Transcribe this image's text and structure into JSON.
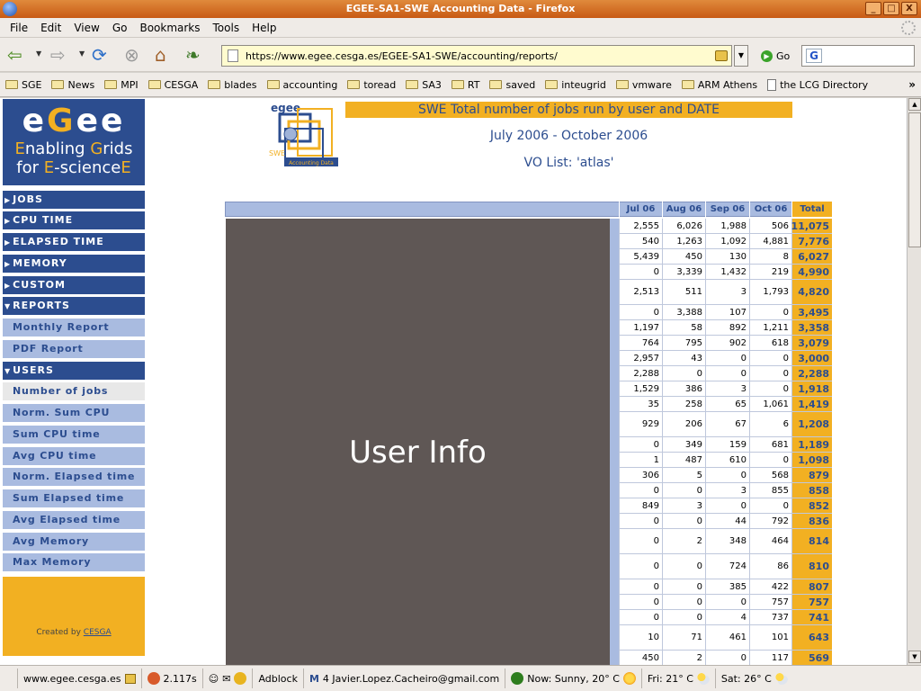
{
  "window": {
    "title": "EGEE-SA1-SWE Accounting Data - Firefox",
    "controls": [
      "_",
      "□",
      "X"
    ]
  },
  "menu": [
    "File",
    "Edit",
    "View",
    "Go",
    "Bookmarks",
    "Tools",
    "Help"
  ],
  "navbar": {
    "url": "https://www.egee.cesga.es/EGEE-SA1-SWE/accounting/reports/",
    "go_label": "Go"
  },
  "bookmarks": [
    "SGE",
    "News",
    "MPI",
    "CESGA",
    "blades",
    "accounting",
    "toread",
    "SA3",
    "RT",
    "saved",
    "inteugrid",
    "vmware",
    "ARM Athens",
    "the LCG Directory"
  ],
  "bookmarks_more": "»",
  "sidebar": {
    "logo": {
      "line1_a": "e",
      "line1_b": "G",
      "line1_c": "ee",
      "line2_a": "E",
      "line2_b": "nabling ",
      "line2_c": "G",
      "line2_d": "rids",
      "line3_a": "for ",
      "line3_b": "E",
      "line3_c": "-science",
      "line3_d": "E"
    },
    "sections": [
      "JOBS",
      "CPU TIME",
      "ELAPSED TIME",
      "MEMORY",
      "CUSTOM",
      "REPORTS"
    ],
    "reports_items": [
      "Monthly Report",
      "PDF Report"
    ],
    "users_label": "USERS",
    "users_items": [
      "Number of jobs",
      "Norm. Sum CPU",
      "Sum CPU time",
      "Avg CPU time",
      "Norm. Elapsed time",
      "Sum Elapsed time",
      "Avg Elapsed time",
      "Avg Memory",
      "Max Memory"
    ],
    "created_prefix": "Created by ",
    "created_link": "CESGA"
  },
  "report": {
    "logo_text": "SWE",
    "logo_caption": "Accounting Data",
    "title": "SWE Total number of jobs run by user and DATE",
    "period": "July 2006 - October 2006",
    "vo": "VO List: 'atlas'",
    "userinfo_label": "User Info",
    "columns": [
      "Jul 06",
      "Aug 06",
      "Sep 06",
      "Oct 06",
      "Total"
    ],
    "rows": [
      [
        "2,555",
        "6,026",
        "1,988",
        "506",
        "11,075"
      ],
      [
        "540",
        "1,263",
        "1,092",
        "4,881",
        "7,776"
      ],
      [
        "5,439",
        "450",
        "130",
        "8",
        "6,027"
      ],
      [
        "0",
        "3,339",
        "1,432",
        "219",
        "4,990"
      ],
      [
        "2,513",
        "511",
        "3",
        "1,793",
        "4,820"
      ],
      [
        "0",
        "3,388",
        "107",
        "0",
        "3,495"
      ],
      [
        "1,197",
        "58",
        "892",
        "1,211",
        "3,358"
      ],
      [
        "764",
        "795",
        "902",
        "618",
        "3,079"
      ],
      [
        "2,957",
        "43",
        "0",
        "0",
        "3,000"
      ],
      [
        "2,288",
        "0",
        "0",
        "0",
        "2,288"
      ],
      [
        "1,529",
        "386",
        "3",
        "0",
        "1,918"
      ],
      [
        "35",
        "258",
        "65",
        "1,061",
        "1,419"
      ],
      [
        "929",
        "206",
        "67",
        "6",
        "1,208"
      ],
      [
        "0",
        "349",
        "159",
        "681",
        "1,189"
      ],
      [
        "1",
        "487",
        "610",
        "0",
        "1,098"
      ],
      [
        "306",
        "5",
        "0",
        "568",
        "879"
      ],
      [
        "0",
        "0",
        "3",
        "855",
        "858"
      ],
      [
        "849",
        "3",
        "0",
        "0",
        "852"
      ],
      [
        "0",
        "0",
        "44",
        "792",
        "836"
      ],
      [
        "0",
        "2",
        "348",
        "464",
        "814"
      ],
      [
        "0",
        "0",
        "724",
        "86",
        "810"
      ],
      [
        "0",
        "0",
        "385",
        "422",
        "807"
      ],
      [
        "0",
        "0",
        "0",
        "757",
        "757"
      ],
      [
        "0",
        "0",
        "4",
        "737",
        "741"
      ],
      [
        "10",
        "71",
        "461",
        "101",
        "643"
      ],
      [
        "450",
        "2",
        "0",
        "117",
        "569"
      ]
    ]
  },
  "statusbar": {
    "host": "www.egee.cesga.es",
    "load_time": "2.117s",
    "adblock": "Adblock",
    "gmail": "4 Javier.Lopez.Cacheiro@gmail.com",
    "weather_now": "Now: Sunny, 20° C",
    "weather_fri": "Fri: 21° C",
    "weather_sat": "Sat: 26° C"
  },
  "colors": {
    "egee_blue": "#2c4d8f",
    "egee_gold": "#f2b022",
    "light_blue": "#a9bbe0",
    "userinfo_bg": "#5f5755"
  }
}
